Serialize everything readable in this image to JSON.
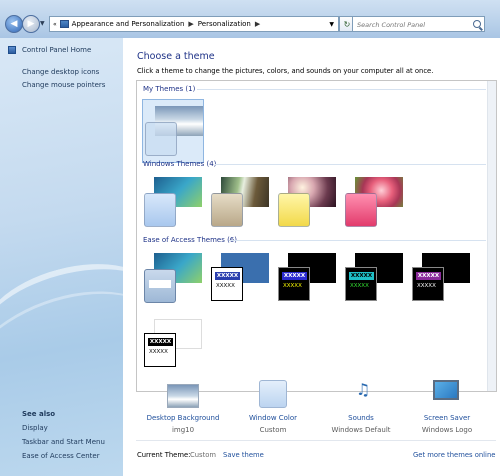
{
  "address": {
    "root_label": "Appearance and Personalization",
    "current_label": "Personalization",
    "separator": "▶"
  },
  "search": {
    "placeholder": "Search Control Panel"
  },
  "sidebar": {
    "home": "Control Panel Home",
    "links": [
      "Change desktop icons",
      "Change mouse pointers"
    ],
    "see_also_title": "See also",
    "see_also": [
      "Display",
      "Taskbar and Start Menu",
      "Ease of Access Center"
    ]
  },
  "main": {
    "heading": "Choose a theme",
    "description": "Click a theme to change the pictures, colors, and sounds on your computer all at once."
  },
  "groups": {
    "my_themes": "My Themes (1)",
    "windows_themes": "Windows Themes (4)",
    "ease_themes": "Ease of Access Themes (6)"
  },
  "contrast_text": {
    "bar": "XXXXX",
    "line": "XXXXX"
  },
  "bottom": {
    "desktop_background": {
      "label": "Desktop Background",
      "sub": "img10"
    },
    "window_color": {
      "label": "Window Color",
      "sub": "Custom"
    },
    "sounds": {
      "label": "Sounds",
      "sub": "Windows Default"
    },
    "screen_saver": {
      "label": "Screen Saver",
      "sub": "Windows Logo"
    }
  },
  "footer": {
    "current_theme_label": "Current Theme:",
    "current_theme_value": "Custom",
    "save_theme": "Save theme",
    "get_more": "Get more themes online"
  },
  "colors": {
    "link": "#1e4e9b",
    "heading": "#1e3287",
    "sidebar_top": "#d9e8f6",
    "selection": "#dbeaf9"
  }
}
